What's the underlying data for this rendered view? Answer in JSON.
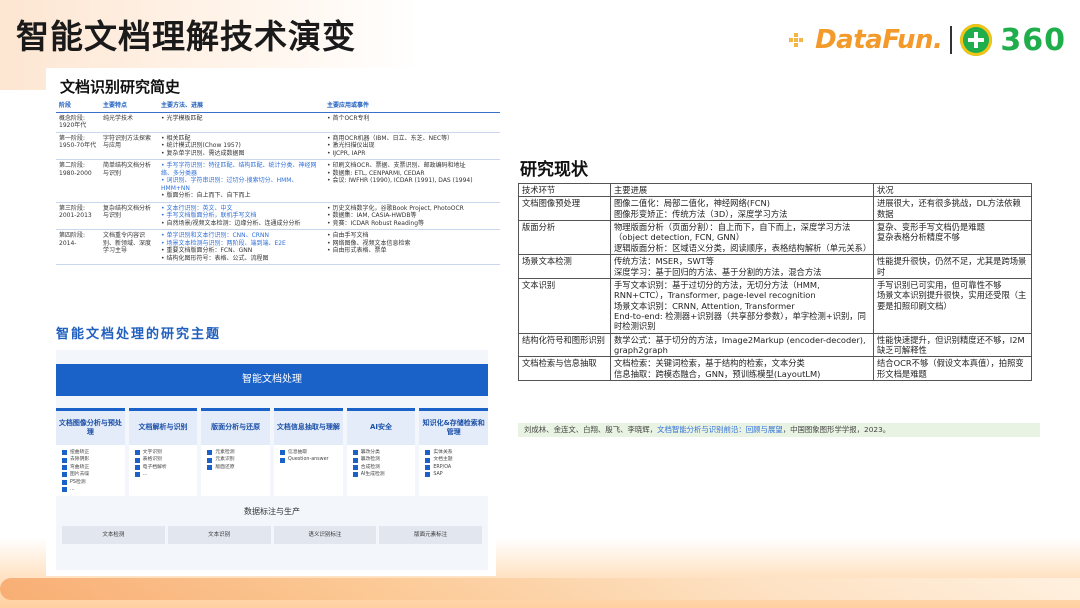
{
  "header": {
    "title": "智能文档理解技术演变",
    "brand_df": "DataFun.",
    "brand_360": "360"
  },
  "history": {
    "title": "文档识别研究简史",
    "columns": [
      "阶段",
      "主要特点",
      "主要方法、进展",
      "主要应用或事件"
    ],
    "rows": [
      {
        "stage": "概念阶段: 1920年代",
        "feature": "纯光学技术",
        "methods": [
          "光学模板匹配"
        ],
        "events": [
          "首个OCR专利"
        ]
      },
      {
        "stage": "第一阶段: 1950-70年代",
        "feature": "字符识别方法探索与应用",
        "methods": [
          "相关匹配",
          "统计模式识别(Chow 1957)",
          "复杂单字识别、需达成数据图"
        ],
        "events": [
          "商用OCR机器（IBM、日立、东芝、NEC等）",
          "激光扫描仪出现",
          "IJCPR, IAPR"
        ]
      },
      {
        "stage": "第二阶段: 1980-2000",
        "feature": "简单结构文档分析与识别",
        "methods": [
          "手写字符识别：特征匹配、结构匹配、统计分类、神经网络、多分类器",
          "词识别、字符串识别：过切分-搜索切分、HMM、HMM+NN",
          "版面分析：自上而下、自下而上"
        ],
        "events": [
          "印刷文档OCR、票据、支票识别、邮政编码和地址",
          "数据集: ETL, CENPARMI, CEDAR",
          "会议: IWFHR (1990), ICDAR (1991), DAS (1994)"
        ]
      },
      {
        "stage": "第三阶段: 2001-2013",
        "feature": "复杂结构文档分析与识别",
        "methods": [
          "文本行识别：英文、中文",
          "手写文档版面分析，联机手写文档",
          "自然场景/视频文本检测：边缘分析、连通成分分析"
        ],
        "events": [
          "历史文档数字化，谷歌Book Project, PhotoOCR",
          "数据集：IAM, CASIA-HWDB等",
          "竞赛：ICDAR Robust Reading等"
        ]
      },
      {
        "stage": "第四阶段: 2014-",
        "feature": "文档重令内容识别、新领域、深度学习主导",
        "methods": [
          "单字识别和文本行识别：CNN、CRNN",
          "场景文本检测与识别：两阶段、端到端、E2E",
          "重要文档版面分析：FCN、GNN",
          "结构化图形符号：表格、公式、流程图"
        ],
        "events": [
          "自由手写文档",
          "网络图像、视频文本信息检索",
          "自由形式表格、票单"
        ]
      }
    ]
  },
  "topics": {
    "title": "智能文档处理的研究主题",
    "head": "智能文档处理",
    "columns": [
      {
        "title": "文档图像分析与预处理",
        "items": [
          "扭曲矫正",
          "去除阴影",
          "弯曲矫正",
          "图片去噪",
          "PS检测",
          "..."
        ]
      },
      {
        "title": "文档解析与识别",
        "items": [
          "文字识别",
          "表格识别",
          "电子档解析",
          "..."
        ]
      },
      {
        "title": "版面分析与还原",
        "items": [
          "元素检测",
          "元素识别",
          "版面还原"
        ]
      },
      {
        "title": "文档信息抽取与理解",
        "items": [
          "信息抽取",
          "Question-answer"
        ]
      },
      {
        "title": "AI安全",
        "items": [
          "篡改分类",
          "篡改检测",
          "合成检测",
          "AI生成检测"
        ]
      },
      {
        "title": "知识化&存储检索和管理",
        "items": [
          "实体关系",
          "文档主题",
          "ERP/OA",
          "SAP"
        ]
      }
    ],
    "data_label": "数据标注与生产",
    "data_cells": [
      "文本检测",
      "文本识别",
      "语义识别标注",
      "版面元素标注"
    ]
  },
  "status": {
    "title": "研究现状",
    "columns": [
      "技术环节",
      "主要进展",
      "状况"
    ],
    "rows": [
      {
        "stage": "文档图像预处理",
        "progress": "图像二值化：局部二值化，神经网络(FCN)\n图像形变矫正：传统方法（3D），深度学习方法",
        "state": "进展很大，还有很多挑战，DL方法依赖数据"
      },
      {
        "stage": "版面分析",
        "progress": "物理版面分析（页面分割）：自上而下，自下而上，深度学习方法（object detection, FCN, GNN）\n逻辑版面分析：区域语义分类，阅读顺序，表格结构解析（单元关系）",
        "state": "复杂、变形手写文档仍是难题\n复杂表格分析精度不够"
      },
      {
        "stage": "场景文本检测",
        "progress": "传统方法：MSER，SWT等\n深度学习：基于回归的方法、基于分割的方法，混合方法",
        "state": "性能提升很快，仍然不足，尤其是跨场景时"
      },
      {
        "stage": "文本识别",
        "progress": "手写文本识别：基于过切分的方法，无切分方法（HMM, RNN+CTC），Transformer, page-level recognition\n场景文本识别：CRNN, Attention, Transformer\nEnd-to-end: 检测器+识别器（共享部分参数），单字检测+识别，同时检测识别",
        "state": "手写识别已可实用，但可靠性不够\n场景文本识别提升很快，实用还受限（主要是扣照印刷文档）"
      },
      {
        "stage": "结构化符号和图形识别",
        "progress": "数学公式：基于切分的方法，Image2Markup (encoder-decoder), graph2graph",
        "state": "性能快速提升，但识别精度还不够，I2M缺乏可解释性"
      },
      {
        "stage": "文档检索与信息抽取",
        "progress": "文档检索：关键词检索，基于结构的检索，文本分类\n信息抽取：跨模态融合，GNN，预训练模型(LayoutLM)",
        "state": "结合OCR不够（假设文本真值），拍照变形文档是难题"
      }
    ],
    "citation_authors": "刘成林、金连文、白翔、殷飞、李晓辉，",
    "citation_link": "文档智能分析与识别前沿：回顾与展望",
    "citation_tail": "，中国图象图形学学报，2023。"
  },
  "colors": {
    "accent_blue": "#1a62c8",
    "brand_orange": "#f39a2b",
    "brand_green": "#1fae4b"
  }
}
